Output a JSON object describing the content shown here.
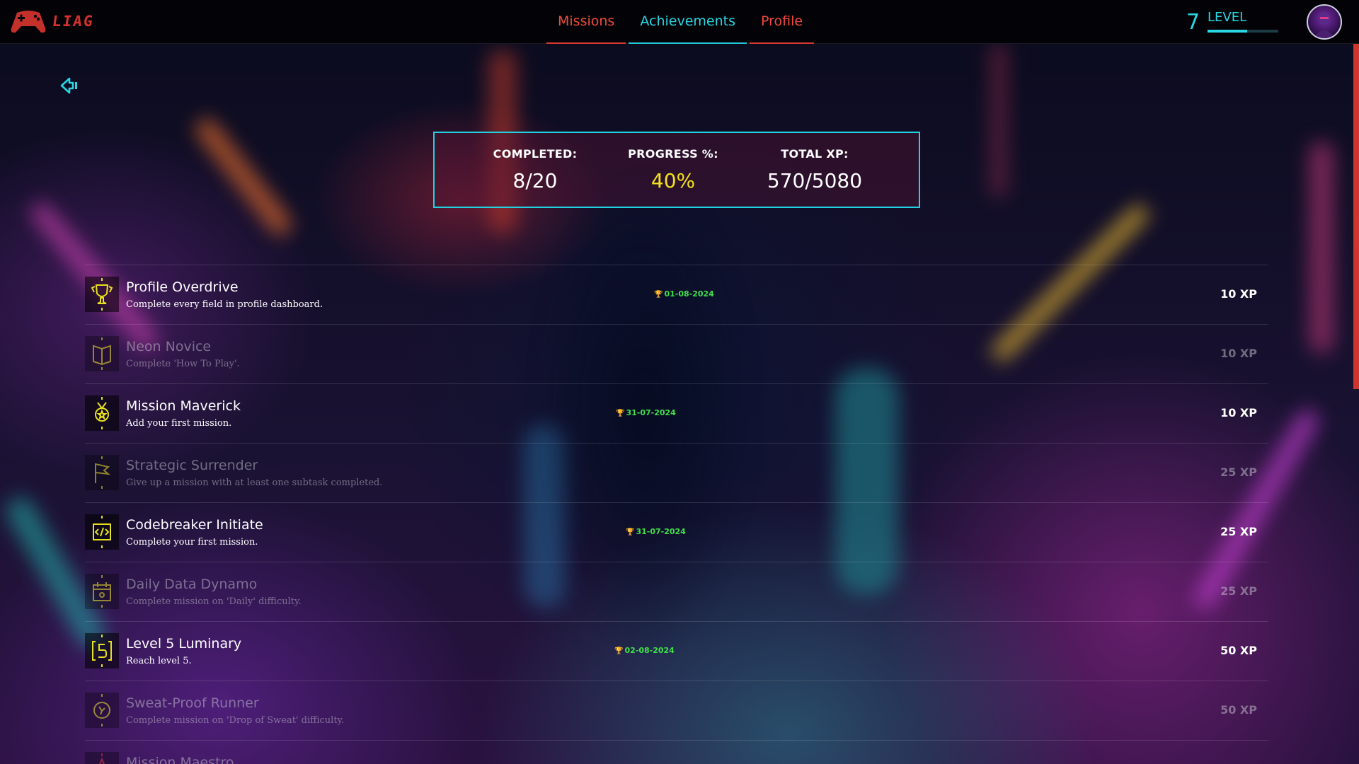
{
  "app": {
    "logo_text": "LIAG"
  },
  "nav": {
    "tabs": [
      {
        "label": "Missions",
        "active": false
      },
      {
        "label": "Achievements",
        "active": true
      },
      {
        "label": "Profile",
        "active": false
      }
    ]
  },
  "level": {
    "number": "7",
    "label": "LEVEL",
    "progress_fraction": 0.56
  },
  "stats": {
    "completed_label": "COMPLETED:",
    "completed_value": "8/20",
    "progress_label": "PROGRESS %:",
    "progress_value": "40%",
    "xp_label": "TOTAL XP:",
    "xp_value": "570/5080"
  },
  "achievements": [
    {
      "title": "Profile Overdrive",
      "desc": "Complete every field in profile dashboard.",
      "date": "01-08-2024",
      "xp": "10 XP",
      "unlocked": true,
      "icon": "trophy-icon"
    },
    {
      "title": "Neon Novice",
      "desc": "Complete 'How To Play'.",
      "date": "",
      "xp": "10 XP",
      "unlocked": false,
      "icon": "book-icon"
    },
    {
      "title": "Mission Maverick",
      "desc": "Add your first mission.",
      "date": "31-07-2024",
      "xp": "10 XP",
      "unlocked": true,
      "icon": "medal-icon"
    },
    {
      "title": "Strategic Surrender",
      "desc": "Give up a mission with at least one subtask completed.",
      "date": "",
      "xp": "25 XP",
      "unlocked": false,
      "icon": "flag-icon"
    },
    {
      "title": "Codebreaker Initiate",
      "desc": "Complete your first mission.",
      "date": "31-07-2024",
      "xp": "25 XP",
      "unlocked": true,
      "icon": "code-icon"
    },
    {
      "title": "Daily Data Dynamo",
      "desc": "Complete mission on 'Daily' difficulty.",
      "date": "",
      "xp": "25 XP",
      "unlocked": false,
      "icon": "calendar-icon"
    },
    {
      "title": "Level 5 Luminary",
      "desc": "Reach level 5.",
      "date": "02-08-2024",
      "xp": "50 XP",
      "unlocked": true,
      "icon": "level-five-icon"
    },
    {
      "title": "Sweat-Proof Runner",
      "desc": "Complete mission on 'Drop of Sweat' difficulty.",
      "date": "",
      "xp": "50 XP",
      "unlocked": false,
      "icon": "runner-icon"
    },
    {
      "title": "Mission Maestro",
      "desc": "",
      "date": "",
      "xp": "",
      "unlocked": false,
      "icon": "star-icon"
    }
  ],
  "colors": {
    "accent": "#29d6e3",
    "brand_red": "#d7322d",
    "progress_yellow": "#f2e21c",
    "unlocked_date": "#3ee049"
  }
}
